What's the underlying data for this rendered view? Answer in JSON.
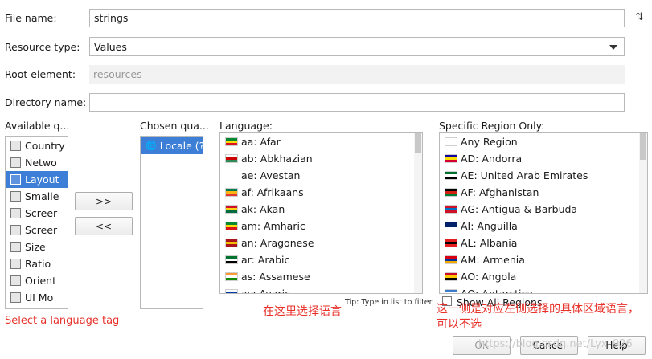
{
  "form": {
    "file_name_label": "File name:",
    "file_name_value": "strings",
    "sort_icon": "sort-arrows-icon",
    "resource_type_label": "Resource type:",
    "resource_type_value": "Values",
    "root_element_label": "Root element:",
    "root_element_placeholder": "resources",
    "directory_name_label": "Directory name:",
    "directory_name_value": ""
  },
  "available": {
    "header": "Available q...",
    "items": [
      {
        "label": "Country (",
        "icon": "country-icon",
        "selected": false
      },
      {
        "label": "Netwo",
        "icon": "network-icon",
        "selected": false
      },
      {
        "label": "Layout",
        "icon": "layout-icon",
        "selected": true
      },
      {
        "label": "Smalle",
        "icon": "smallest-width-icon",
        "selected": false
      },
      {
        "label": "Screer",
        "icon": "screen-width-icon",
        "selected": false
      },
      {
        "label": "Screer",
        "icon": "screen-height-icon",
        "selected": false
      },
      {
        "label": "Size",
        "icon": "size-icon",
        "selected": false
      },
      {
        "label": "Ratio",
        "icon": "ratio-icon",
        "selected": false
      },
      {
        "label": "Orient",
        "icon": "orientation-icon",
        "selected": false
      },
      {
        "label": "UI Mo",
        "icon": "ui-mode-icon",
        "selected": false
      }
    ]
  },
  "buttons": {
    "add": ">>",
    "remove": "<<",
    "ok": "OK",
    "cancel": "Cancel",
    "help": "Help"
  },
  "chosen": {
    "header": "Chosen qua...",
    "items": [
      {
        "label": "Locale (?",
        "icon": "globe-icon"
      }
    ]
  },
  "language": {
    "header": "Language:",
    "tip": "Tip: Type in list to filter",
    "items": [
      {
        "label": "aa: Afar",
        "flag": [
          "#078930",
          "#fcdd09",
          "#da121a"
        ]
      },
      {
        "label": "ab: Abkhazian",
        "flag": [
          "#ffffff",
          "#cc0000",
          "#2e8b57"
        ]
      },
      {
        "label": "ae: Avestan",
        "flag": null
      },
      {
        "label": "af: Afrikaans",
        "flag": [
          "#007a4d",
          "#ffb612",
          "#de3831"
        ]
      },
      {
        "label": "ak: Akan",
        "flag": [
          "#ce1126",
          "#fcd116",
          "#006b3f"
        ]
      },
      {
        "label": "am: Amharic",
        "flag": [
          "#078930",
          "#fcdd09",
          "#da121a"
        ]
      },
      {
        "label": "an: Aragonese",
        "flag": [
          "#aa151b",
          "#f1bf00",
          "#aa151b"
        ]
      },
      {
        "label": "ar: Arabic",
        "flag": [
          "#00732f",
          "#ffffff",
          "#000000"
        ]
      },
      {
        "label": "as: Assamese",
        "flag": [
          "#ff9933",
          "#ffffff",
          "#138808"
        ]
      },
      {
        "label": "av: Avaric",
        "flag": [
          "#ffffff",
          "#0039a6",
          "#d52b1e"
        ]
      }
    ]
  },
  "region": {
    "header": "Specific Region Only:",
    "show_all_label": "Show All Regions",
    "items": [
      {
        "label": "Any Region",
        "flag": [
          "#ffffff",
          "#ffffff",
          "#ffffff"
        ]
      },
      {
        "label": "AD: Andorra",
        "flag": [
          "#10069f",
          "#fedf00",
          "#d50032"
        ]
      },
      {
        "label": "AE: United Arab Emirates",
        "flag": [
          "#00732f",
          "#ffffff",
          "#000000"
        ]
      },
      {
        "label": "AF: Afghanistan",
        "flag": [
          "#000000",
          "#d32011",
          "#007a36"
        ]
      },
      {
        "label": "AG: Antigua & Barbuda",
        "flag": [
          "#ce1126",
          "#0072c6",
          "#ce1126"
        ]
      },
      {
        "label": "AI: Anguilla",
        "flag": [
          "#012169",
          "#012169",
          "#ffffff"
        ]
      },
      {
        "label": "AL: Albania",
        "flag": [
          "#e41e20",
          "#000000",
          "#e41e20"
        ]
      },
      {
        "label": "AM: Armenia",
        "flag": [
          "#d90012",
          "#0033a0",
          "#f2a800"
        ]
      },
      {
        "label": "AO: Angola",
        "flag": [
          "#cc092f",
          "#ffcb00",
          "#000000"
        ]
      },
      {
        "label": "AQ: Antarctica",
        "flag": [
          "#3a7dce",
          "#ffffff",
          "#3a7dce"
        ]
      }
    ]
  },
  "annotations": {
    "select_tag": "Select a language tag",
    "choose_language": "在这里选择语言",
    "region_note_1": "这一侧是对应左侧选择的具体区域语言，",
    "region_note_2": "可以不选"
  },
  "watermark": "https://blog.csdn.net/Lyx_926"
}
